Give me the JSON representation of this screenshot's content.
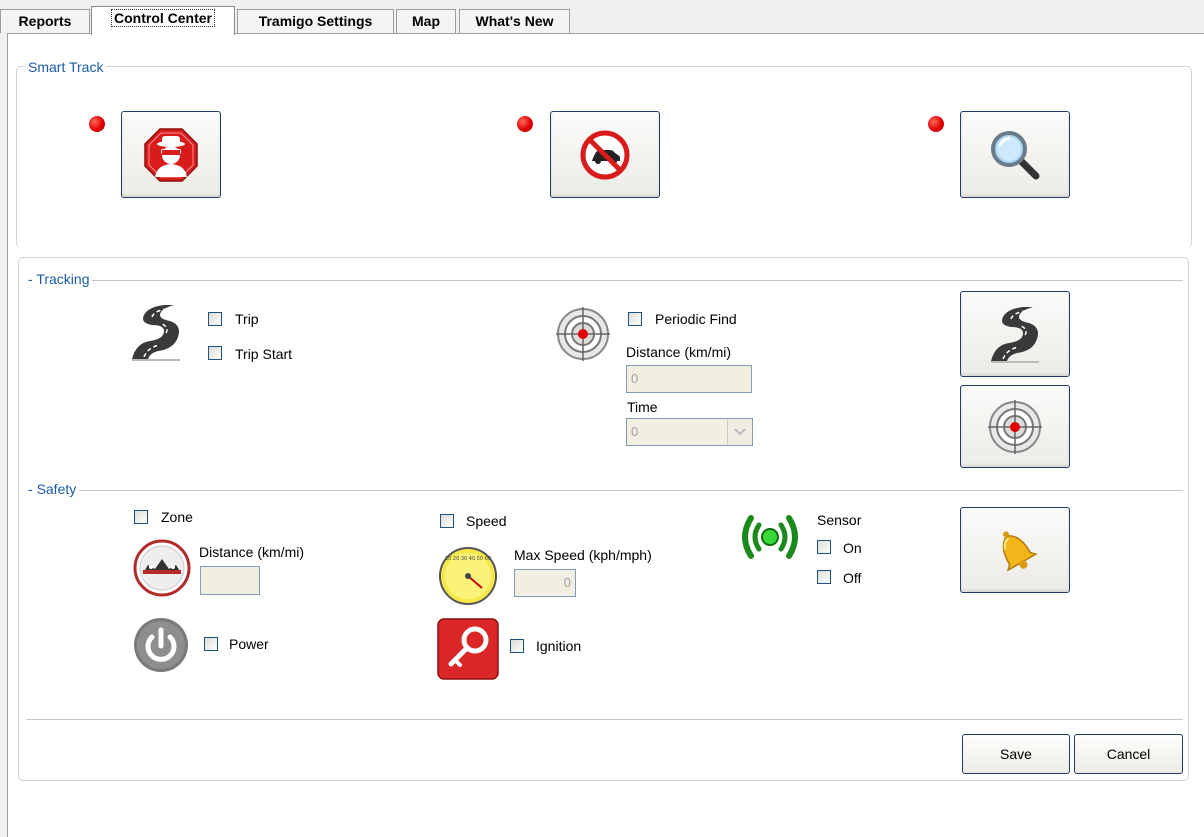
{
  "tabs": [
    {
      "label": "Reports"
    },
    {
      "label": "Control Center"
    },
    {
      "label": "Tramigo Settings"
    },
    {
      "label": "Map"
    },
    {
      "label": "What's New"
    }
  ],
  "smart_track": {
    "title": "Smart Track",
    "buttons": [
      {
        "icon": "thief-alert-icon",
        "status": "red"
      },
      {
        "icon": "no-car-icon",
        "status": "red"
      },
      {
        "icon": "magnifier-icon",
        "status": "red"
      }
    ]
  },
  "tracking": {
    "title": "Tracking",
    "trip_label": "Trip",
    "trip_start_label": "Trip Start",
    "periodic_find_label": "Periodic Find",
    "distance_label": "Distance (km/mi)",
    "distance_value": "0",
    "time_label": "Time",
    "time_value": "0"
  },
  "safety": {
    "title": "Safety",
    "zone_label": "Zone",
    "zone_distance_label": "Distance (km/mi)",
    "zone_distance_value": "",
    "speed_label": "Speed",
    "max_speed_label": "Max Speed  (kph/mph)",
    "max_speed_value": "0",
    "sensor_label": "Sensor",
    "sensor_on_label": "On",
    "sensor_off_label": "Off",
    "power_label": "Power",
    "ignition_label": "Ignition",
    "gauge_ticks": "10 20 30 40 50 60"
  },
  "footer": {
    "save_label": "Save",
    "cancel_label": "Cancel"
  },
  "colors": {
    "accent": "#1a5aa8",
    "status_dot": "#e00000",
    "button_border": "#1f3c6e"
  }
}
